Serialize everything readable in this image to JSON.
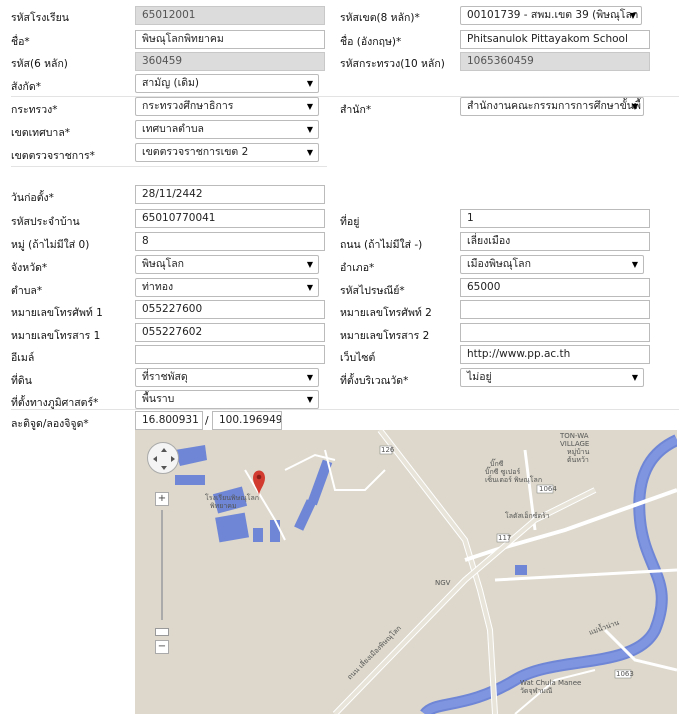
{
  "school_code": {
    "label": "รหัสโรงเรียน",
    "value": "65012001"
  },
  "area_code": {
    "label": "รหัสเขต(8 หลัก)*",
    "value": "00101739 - สพม.เขต 39 (พิษณุโลก"
  },
  "name_th": {
    "label": "ชื่อ*",
    "value": "พิษณุโลกพิทยาคม"
  },
  "name_en": {
    "label": "ชื่อ (อังกฤษ)*",
    "value": "Phitsanulok Pittayakom School"
  },
  "code6": {
    "label": "รหัส(6 หลัก)",
    "value": "360459"
  },
  "ministry_code": {
    "label": "รหัสกระทรวง(10 หลัก)",
    "value": "1065360459"
  },
  "affiliation": {
    "label": "สังกัด*",
    "value": "สามัญ (เดิม)"
  },
  "ministry": {
    "label": "กระทรวง*",
    "value": "กระทรวงศึกษาธิการ"
  },
  "office": {
    "label": "สำนัก*",
    "value": "สำนักงานคณะกรรมการการศึกษาขั้นพื้"
  },
  "municipality": {
    "label": "เขตเทศบาล*",
    "value": "เทศบาลตำบล"
  },
  "inspection": {
    "label": "เขตตรวจราชการ*",
    "value": "เขตตรวจราชการเขต 2"
  },
  "founded": {
    "label": "วันก่อตั้ง*",
    "value": "28/11/2442"
  },
  "house_code": {
    "label": "รหัสประจำบ้าน",
    "value": "65010770041"
  },
  "address": {
    "label": "ที่อยู่",
    "value": "1"
  },
  "moo": {
    "label": "หมู่ (ถ้าไม่มีใส่ 0)",
    "value": "8"
  },
  "road": {
    "label": "ถนน (ถ้าไม่มีใส่ -)",
    "value": "เลี่ยงเมือง"
  },
  "province": {
    "label": "จังหวัด*",
    "value": "พิษณุโลก"
  },
  "district": {
    "label": "อำเภอ*",
    "value": "เมืองพิษณุโลก"
  },
  "subdistrict": {
    "label": "ตำบล*",
    "value": "ท่าทอง"
  },
  "postcode": {
    "label": "รหัสไปรษณีย์*",
    "value": "65000"
  },
  "phone1": {
    "label": "หมายเลขโทรศัพท์ 1",
    "value": "055227600"
  },
  "phone2": {
    "label": "หมายเลขโทรศัพท์ 2",
    "value": ""
  },
  "fax1": {
    "label": "หมายเลขโทรสาร 1",
    "value": "055227602"
  },
  "fax2": {
    "label": "หมายเลขโทรสาร 2",
    "value": ""
  },
  "email": {
    "label": "อีเมล์",
    "value": ""
  },
  "website": {
    "label": "เว็บไซต์",
    "value": "http://www.pp.ac.th"
  },
  "land": {
    "label": "ที่ดิน",
    "value": "ที่ราชพัสดุ"
  },
  "temple": {
    "label": "ที่ตั้งบริเวณวัด*",
    "value": "ไม่อยู่"
  },
  "geography": {
    "label": "ที่ตั้งทางภูมิศาสตร์*",
    "value": "พื้นราบ"
  },
  "latlng": {
    "label": "ละติจูด/ลองจิจูด*",
    "lat": "16.800931",
    "slash": "/",
    "lng": "100.196949"
  },
  "map": {
    "labels": [
      "TON-WA",
      "VILLAGE",
      "หมู่บ้าน",
      "ต้นหว้า",
      "บิ๊กซี",
      "บิ๊กซี ซูเปอร์",
      "เซ็นเตอร์ พิษณุโลก",
      "โลตัสเอ็กซ์ตร้า",
      "โรงเรียนพิษณุโลก",
      "พิทยาคม",
      "NGV",
      "ถนน เลี่ยงเมืองพิษณุโลก",
      "แม่น้ำน่าน",
      "Wat Chula Manee",
      "วัดจุฬามณี",
      "126",
      "1064",
      "1063",
      "117"
    ],
    "zoom_in": "+",
    "zoom_out": "−"
  }
}
